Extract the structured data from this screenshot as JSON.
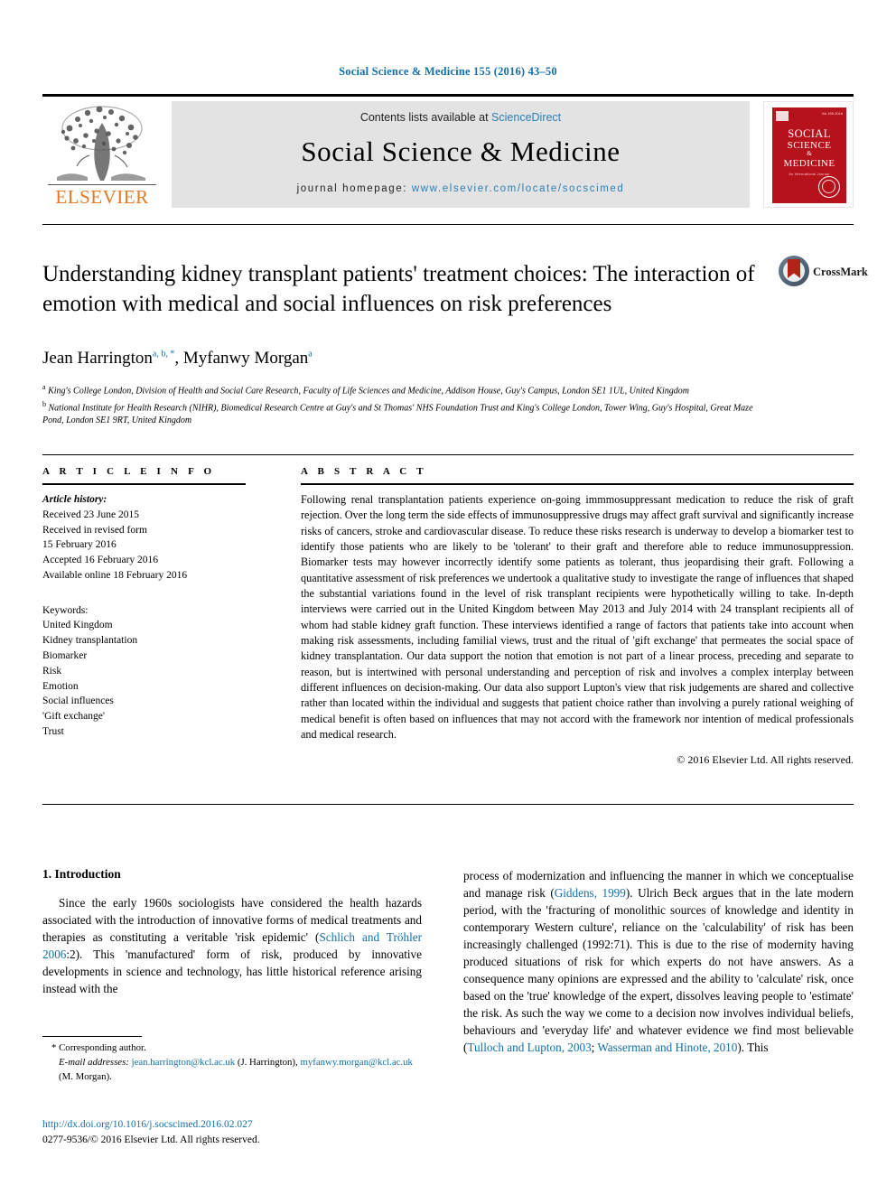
{
  "running_head": "Social Science & Medicine 155 (2016) 43–50",
  "masthead": {
    "publisher_name": "ELSEVIER",
    "contents_prefix": "Contents lists available at",
    "contents_link": "ScienceDirect",
    "journal_title": "Social Science & Medicine",
    "homepage_label": "journal homepage:",
    "homepage_url": "www.elsevier.com/locate/socscimed",
    "cover": {
      "line1": "SOCIAL",
      "line2": "SCIENCE",
      "line3": "&",
      "line4": "MEDICINE",
      "tagline": "An International Journal",
      "issue": "Vol 155 2016",
      "accent_color": "#b5121b"
    }
  },
  "crossmark": {
    "label": "CrossMark"
  },
  "article": {
    "title": "Understanding kidney transplant patients' treatment choices: The interaction of emotion with medical and social influences on risk preferences",
    "authors": [
      {
        "name": "Jean Harrington",
        "marks": "a, b, *"
      },
      {
        "name": "Myfanwy Morgan",
        "marks": "a"
      }
    ],
    "affiliations": [
      {
        "mark": "a",
        "text": "King's College London, Division of Health and Social Care Research, Faculty of Life Sciences and Medicine, Addison House, Guy's Campus, London SE1 1UL, United Kingdom"
      },
      {
        "mark": "b",
        "text": "National Institute for Health Research (NIHR), Biomedical Research Centre at Guy's and St Thomas' NHS Foundation Trust and King's College London, Tower Wing, Guy's Hospital, Great Maze Pond, London SE1 9RT, United Kingdom"
      }
    ]
  },
  "article_info": {
    "heading": "A R T I C L E  I N F O",
    "history_label": "Article history:",
    "history": [
      "Received 23 June 2015",
      "Received in revised form",
      "15 February 2016",
      "Accepted 16 February 2016",
      "Available online 18 February 2016"
    ],
    "keywords_label": "Keywords:",
    "keywords": [
      "United Kingdom",
      "Kidney transplantation",
      "Biomarker",
      "Risk",
      "Emotion",
      "Social influences",
      "'Gift exchange'",
      "Trust"
    ]
  },
  "abstract": {
    "heading": "A B S T R A C T",
    "text": "Following renal transplantation patients experience on-going immmosuppressant medication to reduce the risk of graft rejection. Over the long term the side effects of immunosuppressive drugs may affect graft survival and significantly increase risks of cancers, stroke and cardiovascular disease. To reduce these risks research is underway to develop a biomarker test to identify those patients who are likely to be 'tolerant' to their graft and therefore able to reduce immunosuppression. Biomarker tests may however incorrectly identify some patients as tolerant, thus jeopardising their graft. Following a quantitative assessment of risk preferences we undertook a qualitative study to investigate the range of influences that shaped the substantial variations found in the level of risk transplant recipients were hypothetically willing to take. In-depth interviews were carried out in the United Kingdom between May 2013 and July 2014 with 24 transplant recipients all of whom had stable kidney graft function. These interviews identified a range of factors that patients take into account when making risk assessments, including familial views, trust and the ritual of 'gift exchange' that permeates the social space of kidney transplantation. Our data support the notion that emotion is not part of a linear process, preceding and separate to reason, but is intertwined with personal understanding and perception of risk and involves a complex interplay between different influences on decision-making. Our data also support Lupton's view that risk judgements are shared and collective rather than located within the individual and suggests that patient choice rather than involving a purely rational weighing of medical benefit is often based on influences that may not accord with the framework nor intention of medical professionals and medical research.",
    "copyright": "© 2016 Elsevier Ltd. All rights reserved."
  },
  "introduction": {
    "heading": "1. Introduction",
    "left_paragraph_pre": "Since the early 1960s sociologists have considered the health hazards associated with the introduction of innovative forms of medical treatments and therapies as constituting a veritable 'risk epidemic' (",
    "left_ref_1": "Schlich and Tröhler 2006",
    "left_paragraph_post": ":2). This 'manufactured' form of risk, produced by innovative developments in science and technology, has little historical reference arising instead with the",
    "right_pre_1": "process of modernization and influencing the manner in which we conceptualise and manage risk (",
    "right_ref_1": "Giddens, 1999",
    "right_mid_1": "). Ulrich Beck argues that in the late modern period, with the 'fracturing of monolithic sources of knowledge and identity in contemporary Western culture', reliance on the 'calculability' of risk has been increasingly challenged (1992:71). This is due to the rise of modernity having produced situations of risk for which experts do not have answers. As a consequence many opinions are expressed and the ability to 'calculate' risk, once based on the 'true' knowledge of the expert, dissolves leaving people to 'estimate' the risk. As such the way we come to a decision now involves individual beliefs, behaviours and 'everyday life' and whatever evidence we find most believable (",
    "right_ref_2": "Tulloch and Lupton, 2003",
    "right_sep": "; ",
    "right_ref_3": "Wasserman and Hinote, 2010",
    "right_post": "). This"
  },
  "footnotes": {
    "corresponding_marker": "*",
    "corresponding_label": "Corresponding author.",
    "email_label": "E-mail addresses:",
    "email_1": "jean.harrington@kcl.ac.uk",
    "email_1_owner": "(J. Harrington),",
    "email_2": "myfanwy.morgan@kcl.ac.uk",
    "email_2_owner": "(M. Morgan)."
  },
  "doi_block": {
    "doi_url": "http://dx.doi.org/10.1016/j.socscimed.2016.02.027",
    "issn_line": "0277-9536/© 2016 Elsevier Ltd. All rights reserved."
  },
  "colors": {
    "link": "#1470a8",
    "elsevier_orange": "#e87722",
    "banner_bg": "#e3e3e3"
  }
}
